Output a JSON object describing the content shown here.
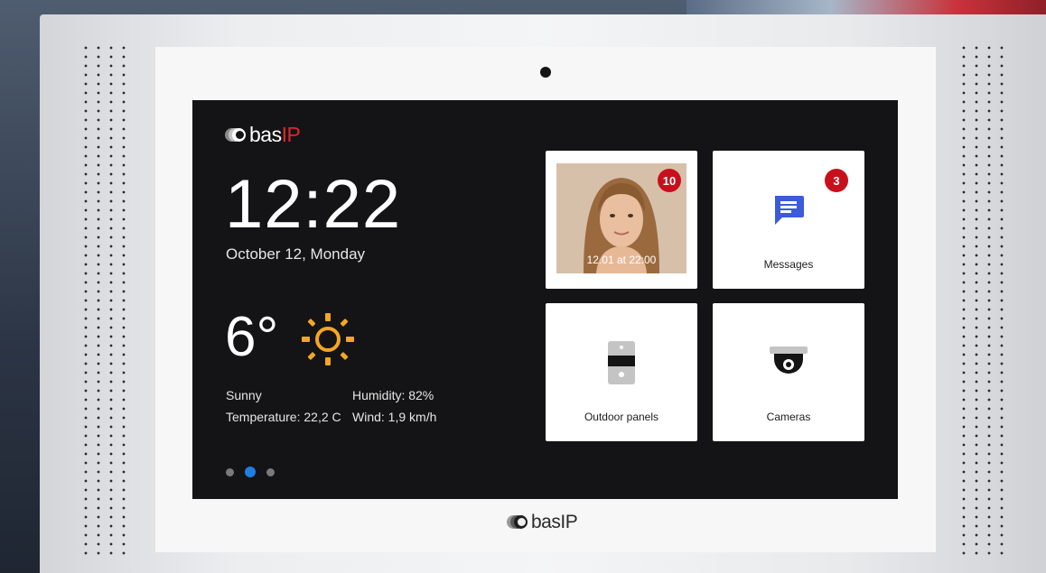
{
  "device": {
    "brand_logo": "basIP",
    "brand_prefix": "bas",
    "brand_suffix": "IP"
  },
  "home": {
    "time": "12:22",
    "date": "October 12, Monday",
    "weather": {
      "temperature": "6°",
      "icon": "sun-icon",
      "condition": "Sunny",
      "temperature_detail": "Temperature: 22,2 C",
      "humidity": "Humidity: 82%",
      "wind": "Wind: 1,9 km/h"
    },
    "page_indicator": {
      "count": 3,
      "active": 2
    }
  },
  "tiles": [
    {
      "name": "visitor-photo",
      "timestamp": "12.01 at 22:00",
      "badge": "10"
    },
    {
      "name": "messages",
      "label": "Messages",
      "badge": "3",
      "icon": "message-icon"
    },
    {
      "name": "outdoor-panels",
      "label": "Outdoor panels",
      "icon": "intercom-panel-icon"
    },
    {
      "name": "cameras",
      "label": "Cameras",
      "icon": "dome-camera-icon"
    }
  ],
  "colors": {
    "accent_red": "#e0262f",
    "badge_red": "#c8101c",
    "active_dot": "#1f7fe0",
    "sun": "#f5a623",
    "message_icon": "#3b5bdb"
  }
}
